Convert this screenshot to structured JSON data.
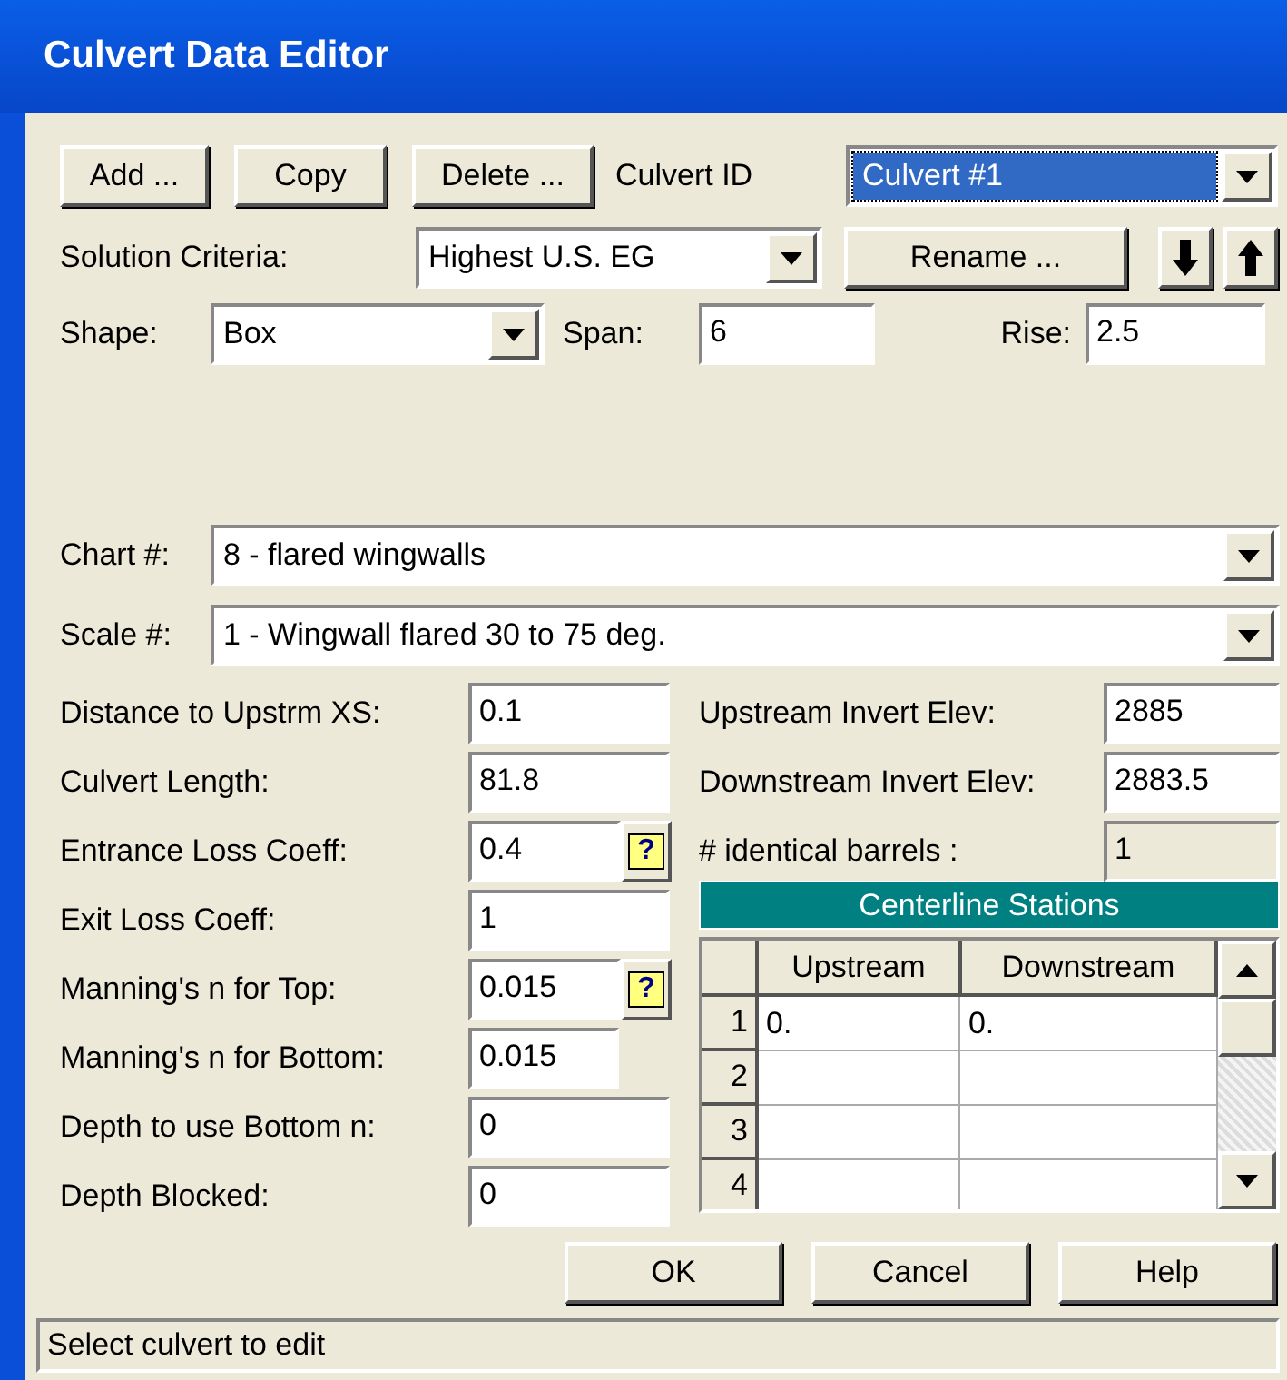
{
  "window": {
    "title": "Culvert Data Editor"
  },
  "toolbar": {
    "buttons": [
      "Add ...",
      "Copy",
      "Delete ..."
    ],
    "culvert_id": {
      "label": "Culvert ID",
      "value": "Culvert #1",
      "selected": true
    }
  },
  "solution_criteria": {
    "label": "Solution Criteria:",
    "value": "Highest U.S. EG"
  },
  "rename_button": "Rename ...",
  "shape": {
    "label": "Shape:",
    "value": "Box"
  },
  "span": {
    "label": "Span:",
    "value": "6"
  },
  "rise": {
    "label": "Rise:",
    "value": "2.5"
  },
  "chart": {
    "label": "Chart #:",
    "value": "8 - flared wingwalls"
  },
  "scale": {
    "label": "Scale #:",
    "value": "1 - Wingwall flared 30 to 75 deg."
  },
  "left_fields": [
    {
      "label": "Distance to Upstrm XS:",
      "value": "0.1"
    },
    {
      "label": "Culvert Length:",
      "value": "81.8"
    },
    {
      "label": "Entrance Loss Coeff:",
      "value": "0.4",
      "help": "?"
    },
    {
      "label": "Exit Loss Coeff:",
      "value": "1"
    },
    {
      "label": "Manning's n for Top:",
      "value": "0.015",
      "help": "?"
    },
    {
      "label": "Manning's n for Bottom:",
      "value": "0.015",
      "kind": "short"
    },
    {
      "label": "Depth to use Bottom n:",
      "value": "0"
    },
    {
      "label": "Depth Blocked:",
      "value": "0"
    }
  ],
  "right_fields": [
    {
      "label": "Upstream Invert Elev:",
      "value": "2885",
      "disabled": false
    },
    {
      "label": "Downstream Invert Elev:",
      "value": "2883.5",
      "disabled": false
    },
    {
      "label": "# identical barrels :",
      "value": "1",
      "disabled": true
    }
  ],
  "centerline_stations": {
    "title": "Centerline Stations",
    "columns": [
      "Upstream",
      "Downstream"
    ],
    "rows": [
      {
        "number": "1",
        "upstream": "0.",
        "downstream": "0."
      },
      {
        "number": "2"
      },
      {
        "number": "3"
      },
      {
        "number": "4"
      }
    ]
  },
  "footer_buttons": [
    "OK",
    "Cancel",
    "Help"
  ],
  "status_bar": "Select culvert to edit"
}
